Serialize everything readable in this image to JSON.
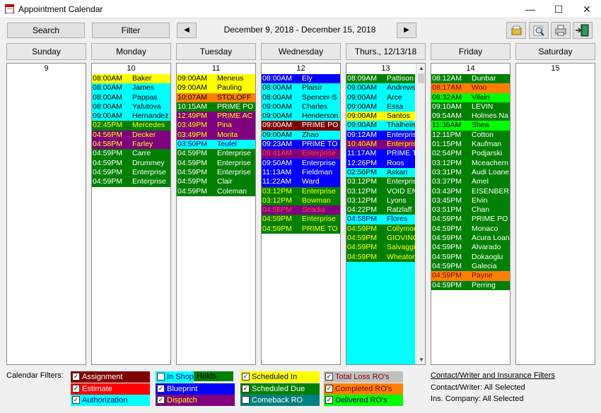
{
  "window": {
    "title": "Appointment Calendar",
    "minimize": "—",
    "maximize": "☐",
    "close": "✕"
  },
  "toolbar": {
    "search_label": "Search",
    "filter_label": "Filter",
    "prev_label": "◀",
    "next_label": "▶",
    "date_range": "December  9, 2018 - December 15, 2018"
  },
  "days": [
    {
      "header": "Sunday",
      "num": "9",
      "appts": []
    },
    {
      "header": "Monday",
      "num": "10",
      "appts": [
        {
          "time": "08:00AM",
          "name": "Baker",
          "bg": "#ffff00",
          "fg": "#000000"
        },
        {
          "time": "08:00AM",
          "name": "James",
          "bg": "#00ffff",
          "fg": "#000000"
        },
        {
          "time": "08:00AM",
          "name": "Pappas",
          "bg": "#00ffff",
          "fg": "#000000"
        },
        {
          "time": "08:00AM",
          "name": "Yafutova",
          "bg": "#00ffff",
          "fg": "#000000"
        },
        {
          "time": "09:00AM",
          "name": "Hernandez",
          "bg": "#00ffff",
          "fg": "#000000"
        },
        {
          "time": "02:45PM",
          "name": "Mercedes",
          "bg": "#008000",
          "fg": "#ffff00"
        },
        {
          "time": "04:56PM",
          "name": "Decker",
          "bg": "#800080",
          "fg": "#ffff00"
        },
        {
          "time": "04:58PM",
          "name": "Farley",
          "bg": "#800080",
          "fg": "#ffff00"
        },
        {
          "time": "04:59PM",
          "name": "Carre",
          "bg": "#008000",
          "fg": "#ffffff"
        },
        {
          "time": "04:59PM",
          "name": "Drummey",
          "bg": "#008000",
          "fg": "#ffffff"
        },
        {
          "time": "04:59PM",
          "name": "Enterprise",
          "bg": "#008000",
          "fg": "#ffffff"
        },
        {
          "time": "04:59PM",
          "name": "Enterprise",
          "bg": "#008000",
          "fg": "#ffffff"
        }
      ]
    },
    {
      "header": "Tuesday",
      "num": "11",
      "appts": [
        {
          "time": "09:00AM",
          "name": "Meneus",
          "bg": "#ffff00",
          "fg": "#000000"
        },
        {
          "time": "09:00AM",
          "name": "Pauling",
          "bg": "#ffff00",
          "fg": "#000000"
        },
        {
          "time": "10:07AM",
          "name": "STOLOFF",
          "bg": "#ff8000",
          "fg": "#000000"
        },
        {
          "time": "10:15AM",
          "name": "PRIME PO",
          "bg": "#008000",
          "fg": "#ffffff"
        },
        {
          "time": "12:49PM",
          "name": "PRIME AC",
          "bg": "#800080",
          "fg": "#ffff00"
        },
        {
          "time": "03:49PM",
          "name": "Pina",
          "bg": "#800080",
          "fg": "#ffff00"
        },
        {
          "time": "03:49PM",
          "name": "Morita",
          "bg": "#800080",
          "fg": "#ffff00"
        },
        {
          "time": "03:50PM",
          "name": "Teufel",
          "bg": "#00ffff",
          "fg": "#000080"
        },
        {
          "time": "04:59PM",
          "name": "Enterprise",
          "bg": "#008000",
          "fg": "#ffffff"
        },
        {
          "time": "04:59PM",
          "name": "Enterprise",
          "bg": "#008000",
          "fg": "#ffffff"
        },
        {
          "time": "04:59PM",
          "name": "Enterprise",
          "bg": "#008000",
          "fg": "#ffffff"
        },
        {
          "time": "04:59PM",
          "name": "Clair",
          "bg": "#008000",
          "fg": "#ffffff"
        },
        {
          "time": "04:59PM",
          "name": "Coleman",
          "bg": "#008000",
          "fg": "#ffffff"
        }
      ]
    },
    {
      "header": "Wednesday",
      "num": "12",
      "appts": [
        {
          "time": "08:00AM",
          "name": "Ely",
          "bg": "#0000ff",
          "fg": "#ffffff"
        },
        {
          "time": "08:00AM",
          "name": "Plaisir",
          "bg": "#00ffff",
          "fg": "#000000"
        },
        {
          "time": "08:00AM",
          "name": "Spencer-S",
          "bg": "#00ffff",
          "fg": "#000000"
        },
        {
          "time": "09:00AM",
          "name": "Charles",
          "bg": "#00ffff",
          "fg": "#000000"
        },
        {
          "time": "09:00AM",
          "name": "Henderson",
          "bg": "#00ffff",
          "fg": "#000000"
        },
        {
          "time": "09:00AM",
          "name": "PRIME PO",
          "bg": "#800000",
          "fg": "#ffffff"
        },
        {
          "time": "09:00AM",
          "name": "Zhao",
          "bg": "#00ffff",
          "fg": "#000000"
        },
        {
          "time": "09:23AM",
          "name": "PRIME TO",
          "bg": "#0000ff",
          "fg": "#ffffff"
        },
        {
          "time": "09:41AM",
          "name": "Enterprise",
          "bg": "#800080",
          "fg": "#ff4040"
        },
        {
          "time": "09:50AM",
          "name": "Enterprise",
          "bg": "#0000ff",
          "fg": "#ffffff"
        },
        {
          "time": "11:13AM",
          "name": "Fieldman",
          "bg": "#0000ff",
          "fg": "#ffffff"
        },
        {
          "time": "11:22AM",
          "name": "Ward",
          "bg": "#0000ff",
          "fg": "#ffffff"
        },
        {
          "time": "03:12PM",
          "name": "Enterprise",
          "bg": "#008000",
          "fg": "#ffff00"
        },
        {
          "time": "03:12PM",
          "name": "Bowman",
          "bg": "#008000",
          "fg": "#ffff00"
        },
        {
          "time": "04:58PM",
          "name": "Seadia",
          "bg": "#800080",
          "fg": "#ff4040"
        },
        {
          "time": "04:59PM",
          "name": "Enterprise",
          "bg": "#008000",
          "fg": "#ffff00"
        },
        {
          "time": "04:59PM",
          "name": "PRIME TO",
          "bg": "#008000",
          "fg": "#ffff00"
        }
      ]
    },
    {
      "header": "Thurs., 12/13/18",
      "num": "13",
      "appts": [
        {
          "time": "08:09AM",
          "name": "Pattison",
          "bg": "#008000",
          "fg": "#ffffff"
        },
        {
          "time": "09:00AM",
          "name": "Andrews",
          "bg": "#00ffff",
          "fg": "#000000"
        },
        {
          "time": "09:00AM",
          "name": "Arce",
          "bg": "#00ffff",
          "fg": "#000000"
        },
        {
          "time": "09:00AM",
          "name": "Essa",
          "bg": "#00ffff",
          "fg": "#000000"
        },
        {
          "time": "09:00AM",
          "name": "Santos",
          "bg": "#ffff00",
          "fg": "#000000"
        },
        {
          "time": "09:00AM",
          "name": "Thalheim",
          "bg": "#00ffff",
          "fg": "#000000"
        },
        {
          "time": "09:12AM",
          "name": "Enterprise",
          "bg": "#0000ff",
          "fg": "#ffffff"
        },
        {
          "time": "10:40AM",
          "name": "Enterprise",
          "bg": "#800080",
          "fg": "#ffff00"
        },
        {
          "time": "11:17AM",
          "name": "PRIME T",
          "bg": "#0000ff",
          "fg": "#ffffff"
        },
        {
          "time": "12:26PM",
          "name": "Roos",
          "bg": "#0000ff",
          "fg": "#ffffff"
        },
        {
          "time": "02:56PM",
          "name": "Askari",
          "bg": "#00ffff",
          "fg": "#000000"
        },
        {
          "time": "03:12PM",
          "name": "Enterprise",
          "bg": "#008000",
          "fg": "#ffffff"
        },
        {
          "time": "03:12PM",
          "name": "VOID EN",
          "bg": "#008000",
          "fg": "#ffffff"
        },
        {
          "time": "03:12PM",
          "name": "Lyons",
          "bg": "#008000",
          "fg": "#ffffff"
        },
        {
          "time": "04:22PM",
          "name": "Ratzlaff",
          "bg": "#008000",
          "fg": "#ffffff"
        },
        {
          "time": "04:58PM",
          "name": "Flores",
          "bg": "#00ffff",
          "fg": "#000080"
        },
        {
          "time": "04:59PM",
          "name": "Collymore",
          "bg": "#008000",
          "fg": "#ffff00"
        },
        {
          "time": "04:59PM",
          "name": "GIOVINO",
          "bg": "#008000",
          "fg": "#ffff00"
        },
        {
          "time": "04:59PM",
          "name": "Salvaggio",
          "bg": "#008000",
          "fg": "#ffff00"
        },
        {
          "time": "04:59PM",
          "name": "Wheaton",
          "bg": "#008000",
          "fg": "#ffff00"
        }
      ]
    },
    {
      "header": "Friday",
      "num": "14",
      "appts": [
        {
          "time": "08:12AM",
          "name": "Dunbar",
          "bg": "#008000",
          "fg": "#ffffff"
        },
        {
          "time": "08:17AM",
          "name": "Woo",
          "bg": "#ff8000",
          "fg": "#800000"
        },
        {
          "time": "08:32AM",
          "name": "Vilain",
          "bg": "#00ff00",
          "fg": "#000000"
        },
        {
          "time": "09:10AM",
          "name": "LEVIN",
          "bg": "#008000",
          "fg": "#ffffff"
        },
        {
          "time": "09:54AM",
          "name": "Holmes Na",
          "bg": "#008000",
          "fg": "#ffffff"
        },
        {
          "time": "11:36AM",
          "name": "Shea",
          "bg": "#00ff00",
          "fg": "#000000"
        },
        {
          "time": "12:11PM",
          "name": "Cotton",
          "bg": "#008000",
          "fg": "#ffffff"
        },
        {
          "time": "01:15PM",
          "name": "Kaufman",
          "bg": "#008000",
          "fg": "#ffffff"
        },
        {
          "time": "02:54PM",
          "name": "Podjarski",
          "bg": "#008000",
          "fg": "#ffffff"
        },
        {
          "time": "03:12PM",
          "name": "Mceachern",
          "bg": "#008000",
          "fg": "#ffffff"
        },
        {
          "time": "03:31PM",
          "name": "Audi Loane",
          "bg": "#008000",
          "fg": "#ffffff"
        },
        {
          "time": "03:37PM",
          "name": "Amel",
          "bg": "#008000",
          "fg": "#ffffff"
        },
        {
          "time": "03:43PM",
          "name": "EISENBER",
          "bg": "#008000",
          "fg": "#ffffff"
        },
        {
          "time": "03:45PM",
          "name": "Elvin",
          "bg": "#008000",
          "fg": "#ffffff"
        },
        {
          "time": "03:51PM",
          "name": "Chan",
          "bg": "#008000",
          "fg": "#ffffff"
        },
        {
          "time": "04:59PM",
          "name": "PRIME PO",
          "bg": "#008000",
          "fg": "#ffffff"
        },
        {
          "time": "04:59PM",
          "name": "Monaco",
          "bg": "#008000",
          "fg": "#ffffff"
        },
        {
          "time": "04:59PM",
          "name": "Acura Loan",
          "bg": "#008000",
          "fg": "#ffffff"
        },
        {
          "time": "04:59PM",
          "name": "Alvarado",
          "bg": "#008000",
          "fg": "#ffffff"
        },
        {
          "time": "04:59PM",
          "name": "Dokaoglu",
          "bg": "#008000",
          "fg": "#ffffff"
        },
        {
          "time": "04:59PM",
          "name": "Galecia",
          "bg": "#008000",
          "fg": "#ffffff"
        },
        {
          "time": "04:59PM",
          "name": "Payne",
          "bg": "#ff8000",
          "fg": "#800000"
        },
        {
          "time": "04:59PM",
          "name": "Perring",
          "bg": "#008000",
          "fg": "#ffffff"
        }
      ]
    },
    {
      "header": "Saturday",
      "num": "15",
      "appts": []
    }
  ],
  "filters": {
    "label": "Calendar Filters:",
    "items": [
      {
        "label": "Assignment",
        "checked": true,
        "bg": "#800000",
        "fg": "#ffffff"
      },
      {
        "label": "Estimate",
        "checked": true,
        "bg": "#ff0000",
        "fg": "#ffffff"
      },
      {
        "label": "Authorization",
        "checked": true,
        "bg": "#00ffff",
        "fg": "#000080"
      },
      {
        "label": "In Shop",
        "checked": false,
        "bg": "#00ffff",
        "fg": "#000080"
      },
      {
        "label": "Blueprint",
        "checked": true,
        "bg": "#0000ff",
        "fg": "#ffffff"
      },
      {
        "label": "Dispatch",
        "checked": true,
        "bg": "#800080",
        "fg": "#ffff00"
      },
      {
        "label": "Scheduled In",
        "checked": true,
        "bg": "#ffff00",
        "fg": "#000080"
      },
      {
        "label": "Scheduled Due",
        "checked": true,
        "bg": "#008000",
        "fg": "#ffffff"
      },
      {
        "label": "Comeback RO",
        "checked": false,
        "bg": "#008080",
        "fg": "#ffffff"
      },
      {
        "label": "Total Loss RO's",
        "checked": true,
        "bg": "#c0c0c0",
        "fg": "#800000"
      },
      {
        "label": "Completed RO's",
        "checked": true,
        "bg": "#ff8000",
        "fg": "#800000"
      },
      {
        "label": "Delivered RO's",
        "checked": true,
        "bg": "#00ff00",
        "fg": "#000080"
      }
    ],
    "holds_label": "Holds",
    "holds_color": "#008000"
  },
  "contact_filters": {
    "link": "Contact/Writer and Insurance Filters",
    "writer": "Contact/Writer: All Selected",
    "company": "Ins. Company:  All Selected"
  }
}
